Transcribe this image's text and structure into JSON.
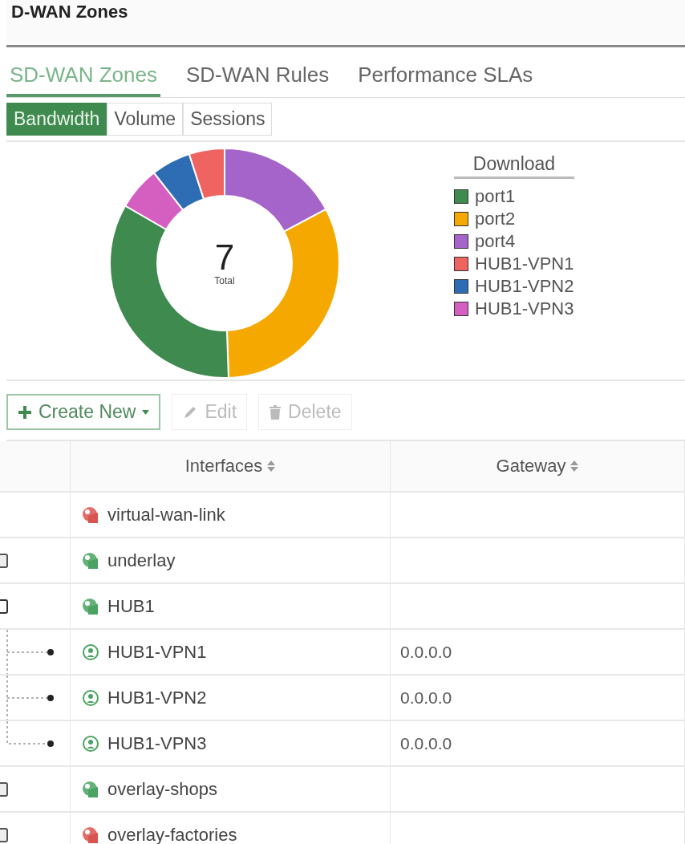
{
  "page_title": "D-WAN Zones",
  "tabs": [
    {
      "label": "SD-WAN Zones",
      "selected": true
    },
    {
      "label": "SD-WAN Rules",
      "selected": false
    },
    {
      "label": "Performance SLAs",
      "selected": false
    }
  ],
  "view_tabs": [
    {
      "label": "Bandwidth",
      "selected": true
    },
    {
      "label": "Volume",
      "selected": false
    },
    {
      "label": "Sessions",
      "selected": false
    }
  ],
  "chart": {
    "total": "7",
    "total_label": "Total",
    "legend_title": "Download",
    "legend": [
      {
        "label": "port1",
        "color": "#3f8a4f"
      },
      {
        "label": "port2",
        "color": "#f5a800"
      },
      {
        "label": "port4",
        "color": "#a564c9"
      },
      {
        "label": "HUB1-VPN1",
        "color": "#ef6461"
      },
      {
        "label": "HUB1-VPN2",
        "color": "#2e6db4"
      },
      {
        "label": "HUB1-VPN3",
        "color": "#d55fc1"
      }
    ]
  },
  "toolbar": [
    {
      "label": "Create New",
      "kind": "create",
      "disabled": false
    },
    {
      "label": "Edit",
      "kind": "edit",
      "disabled": true
    },
    {
      "label": "Delete",
      "kind": "delete",
      "disabled": true
    }
  ],
  "table": {
    "columns": [
      "Interfaces",
      "Gateway"
    ],
    "rows": [
      {
        "interface": "virtual-wan-link",
        "up": false
      },
      {
        "interface": "underlay",
        "up": true,
        "expanded": false
      },
      {
        "interface": "HUB1",
        "up": true,
        "expanded": true,
        "children": [
          {
            "interface": "HUB1-VPN1",
            "up": true,
            "gateway": "0.0.0.0"
          },
          {
            "interface": "HUB1-VPN2",
            "up": true,
            "gateway": "0.0.0.0"
          },
          {
            "interface": "HUB1-VPN3",
            "up": true,
            "gateway": "0.0.0.0"
          }
        ]
      },
      {
        "interface": "overlay-shops",
        "up": true,
        "expanded": false
      },
      {
        "interface": "overlay-factories",
        "up": false,
        "expanded": false
      }
    ]
  }
}
